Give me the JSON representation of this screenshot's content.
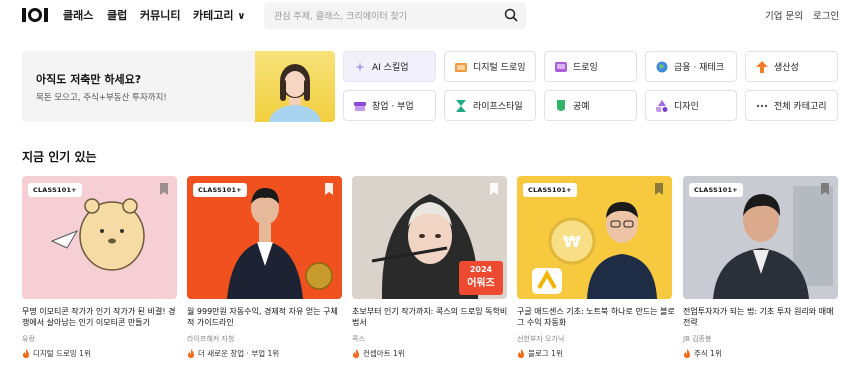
{
  "header": {
    "nav": [
      "클래스",
      "클럽",
      "커뮤니티",
      "카테고리"
    ],
    "nav_chevron": "∨",
    "search_placeholder": "관심 주제, 클래스, 크리에이터 찾기",
    "enterprise_link": "기업 문의",
    "login_link": "로그인"
  },
  "promo": {
    "title": "아직도 저축만 하세요?",
    "subtitle": "목돈 모으고, 주식+부동산 투자까지!"
  },
  "categories": [
    {
      "label": "AI 스킬업",
      "icon": "sparkle-icon",
      "color": "#a99de6"
    },
    {
      "label": "디지털 드로잉",
      "icon": "drawing-icon",
      "color": "#f39a3c"
    },
    {
      "label": "드로잉",
      "icon": "drawing-board-icon",
      "color": "#a85fd8"
    },
    {
      "label": "금융 · 재테크",
      "icon": "globe-icon",
      "color": "#3d8be0"
    },
    {
      "label": "생산성",
      "icon": "arrow-up-icon",
      "color": "#f27b2a"
    },
    {
      "label": "창업 · 부업",
      "icon": "store-icon",
      "color": "#8e49d6"
    },
    {
      "label": "라이프스타일",
      "icon": "hourglass-icon",
      "color": "#22a883"
    },
    {
      "label": "공예",
      "icon": "craft-icon",
      "color": "#34b36b"
    },
    {
      "label": "디자인",
      "icon": "shapes-icon",
      "color": "#a26ce0"
    },
    {
      "label": "전체 카테고리",
      "icon": "more-icon",
      "color": "#555555"
    }
  ],
  "section_title": "지금 인기 있는",
  "cards": [
    {
      "badge": "CLASS101+",
      "title": "무명 이모티콘 작가가 인기 작가가 된 비결! 경쟁에서 살아남는 인기 이모티콘 만들기",
      "creator": "유랑",
      "rank": "디지털 드로잉 1위",
      "bg": "#f6cfd4"
    },
    {
      "badge": "CLASS101+",
      "title": "월 999만원 자동수익, 경제적 자유 얻는 구체적 가이드라인",
      "creator": "라이프해커 자청",
      "rank": "더 새로운 창업 · 부업 1위",
      "bg": "#f0511f"
    },
    {
      "badge": "",
      "title": "초보부터 인기 작가까지: 콕스의 드로잉 독학비법서",
      "creator": "콕스",
      "rank": "컨셉아트 1위",
      "bg": "#d9d3cb",
      "tag_year": "2024",
      "tag_label": "어워즈"
    },
    {
      "badge": "CLASS101+",
      "title": "구글 애드센스 기초: 노트북 하나로 만드는 블로그 수익 자동화",
      "creator": "선한부자 오가닉",
      "rank": "블로그 1위",
      "bg": "#f6c93e"
    },
    {
      "badge": "CLASS101+",
      "title": "전업투자자가 되는 법: 기초 투자 원리와 매매 전략",
      "creator": "JB 김종봉",
      "rank": "주식 1위",
      "bg": "#cfd3d8"
    }
  ]
}
